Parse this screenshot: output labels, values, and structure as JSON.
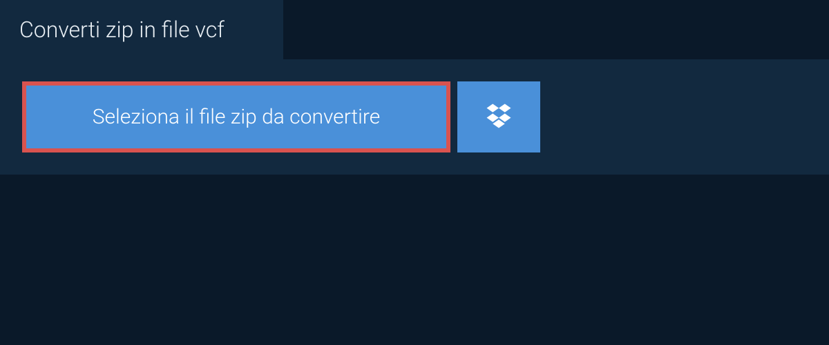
{
  "tab": {
    "title": "Converti zip in file vcf"
  },
  "actions": {
    "select_file_label": "Seleziona il file zip da convertire"
  },
  "colors": {
    "background": "#0a1929",
    "panel": "#12293f",
    "button": "#4a90d9",
    "highlight_border": "#d9534f",
    "text_light": "#ffffff"
  },
  "icons": {
    "dropbox": "dropbox-icon"
  }
}
